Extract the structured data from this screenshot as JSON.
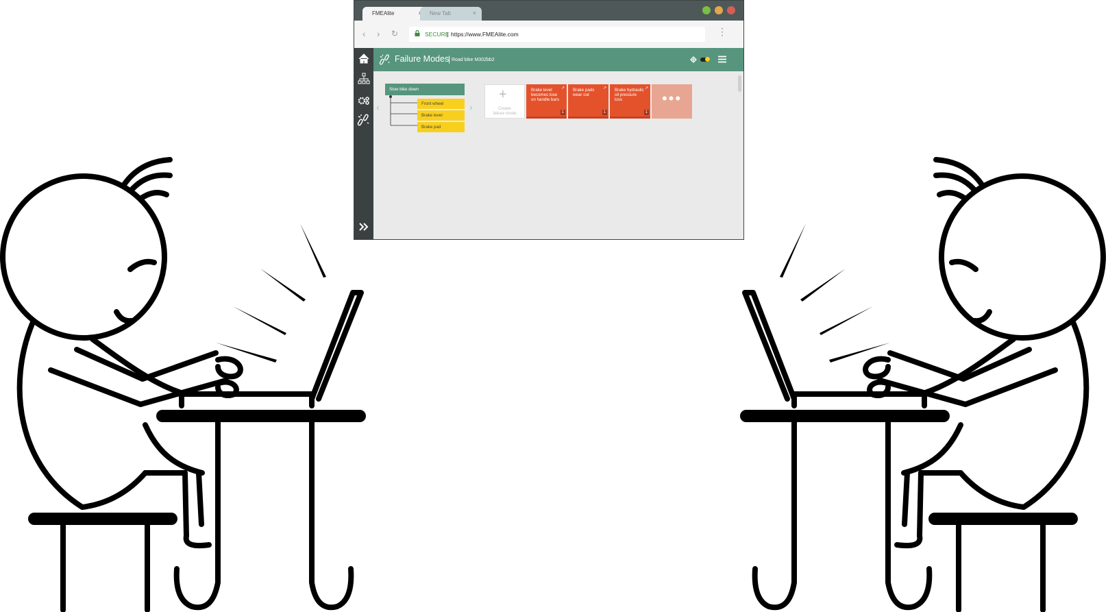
{
  "browser": {
    "tabs": [
      {
        "label": "FMEAlite",
        "close": "×"
      },
      {
        "label": "New Tab",
        "close": "×"
      }
    ],
    "secure_label": "SECURE",
    "url_separator": "|",
    "url": "https://www.FMEAlite.com"
  },
  "app": {
    "title": "Failure Modes",
    "title_separator": "|",
    "subtitle": "Road bike M302bb2",
    "tree": {
      "root": "Slow bike down",
      "children": [
        "Front wheel",
        "Brake lever",
        "Brake pad"
      ]
    },
    "new_card": {
      "plus": "+",
      "label_line1": "Create",
      "label_line2": "failure mode"
    },
    "failure_modes": [
      {
        "label": "Brake level becomes lose on handle bars",
        "count": "1"
      },
      {
        "label": "Brake pads wear out",
        "count": "1"
      },
      {
        "label": "Brake hydraulic oil pressure loss",
        "count": "1"
      }
    ],
    "more": "•••"
  },
  "colors": {
    "header": "#57957f",
    "sidebar": "#3a4140",
    "failure_card": "#e4522c",
    "component": "#f9cf1d"
  }
}
